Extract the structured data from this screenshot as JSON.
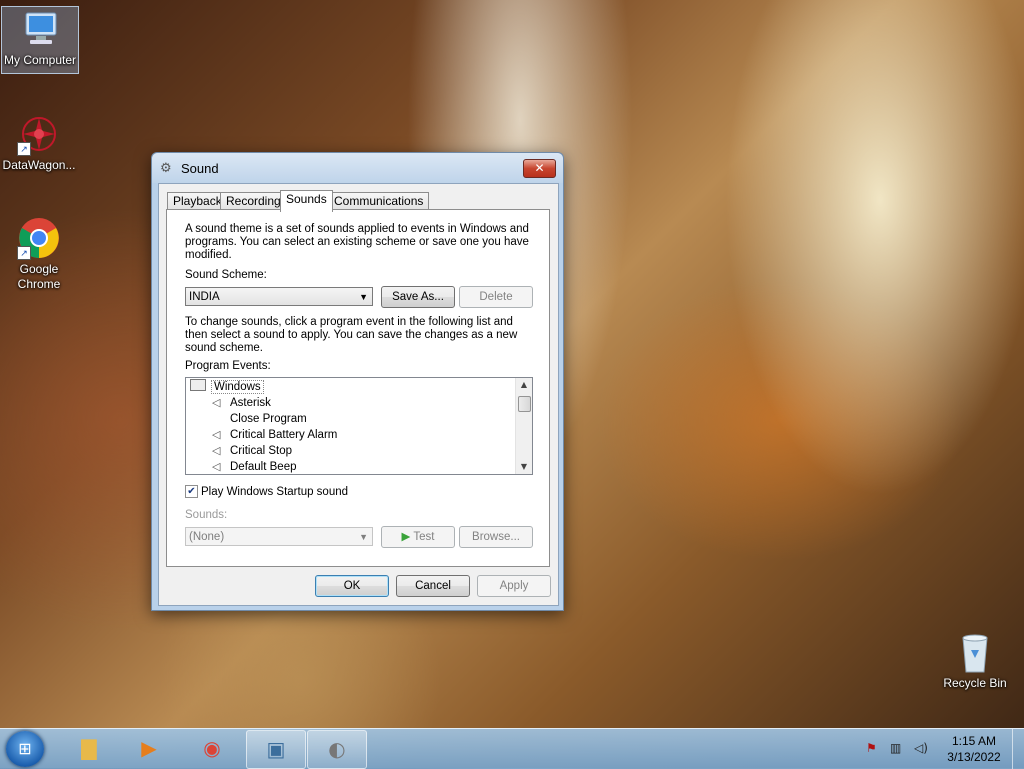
{
  "desktop": {
    "icons": [
      {
        "label": "My Computer",
        "icon": "computer-icon"
      },
      {
        "label": "DataWagon...",
        "icon": "datawagon-icon"
      },
      {
        "label": "Google Chrome",
        "icon": "chrome-icon"
      },
      {
        "label": "Recycle Bin",
        "icon": "recycle-bin-icon"
      }
    ]
  },
  "dialog": {
    "title": "Sound",
    "close_label": "✕",
    "tabs": [
      "Playback",
      "Recording",
      "Sounds",
      "Communications"
    ],
    "active_tab": "Sounds",
    "description": "A sound theme is a set of sounds applied to events in Windows and programs.  You can select an existing scheme or save one you have modified.",
    "scheme_label": "Sound Scheme:",
    "scheme_value": "INDIA",
    "save_as_label": "Save As...",
    "delete_label": "Delete",
    "change_text": "To change sounds, click a program event in the following list and then select a sound to apply.  You can save the changes as a new sound scheme.",
    "events_label": "Program Events:",
    "events_group": "Windows",
    "events": [
      {
        "label": "Asterisk",
        "has_sound": true
      },
      {
        "label": "Close Program",
        "has_sound": false
      },
      {
        "label": "Critical Battery Alarm",
        "has_sound": true
      },
      {
        "label": "Critical Stop",
        "has_sound": true
      },
      {
        "label": "Default Beep",
        "has_sound": true
      }
    ],
    "startup_checkbox_label": "Play Windows Startup sound",
    "startup_checked": true,
    "sounds_label": "Sounds:",
    "sounds_value": "(None)",
    "test_label": "Test",
    "browse_label": "Browse...",
    "ok_label": "OK",
    "cancel_label": "Cancel",
    "apply_label": "Apply"
  },
  "taskbar": {
    "items": [
      "windows-explorer-icon",
      "media-player-icon",
      "chrome-icon",
      "picture-icon",
      "speaker-icon"
    ],
    "time": "1:15 AM",
    "date": "3/13/2022"
  }
}
